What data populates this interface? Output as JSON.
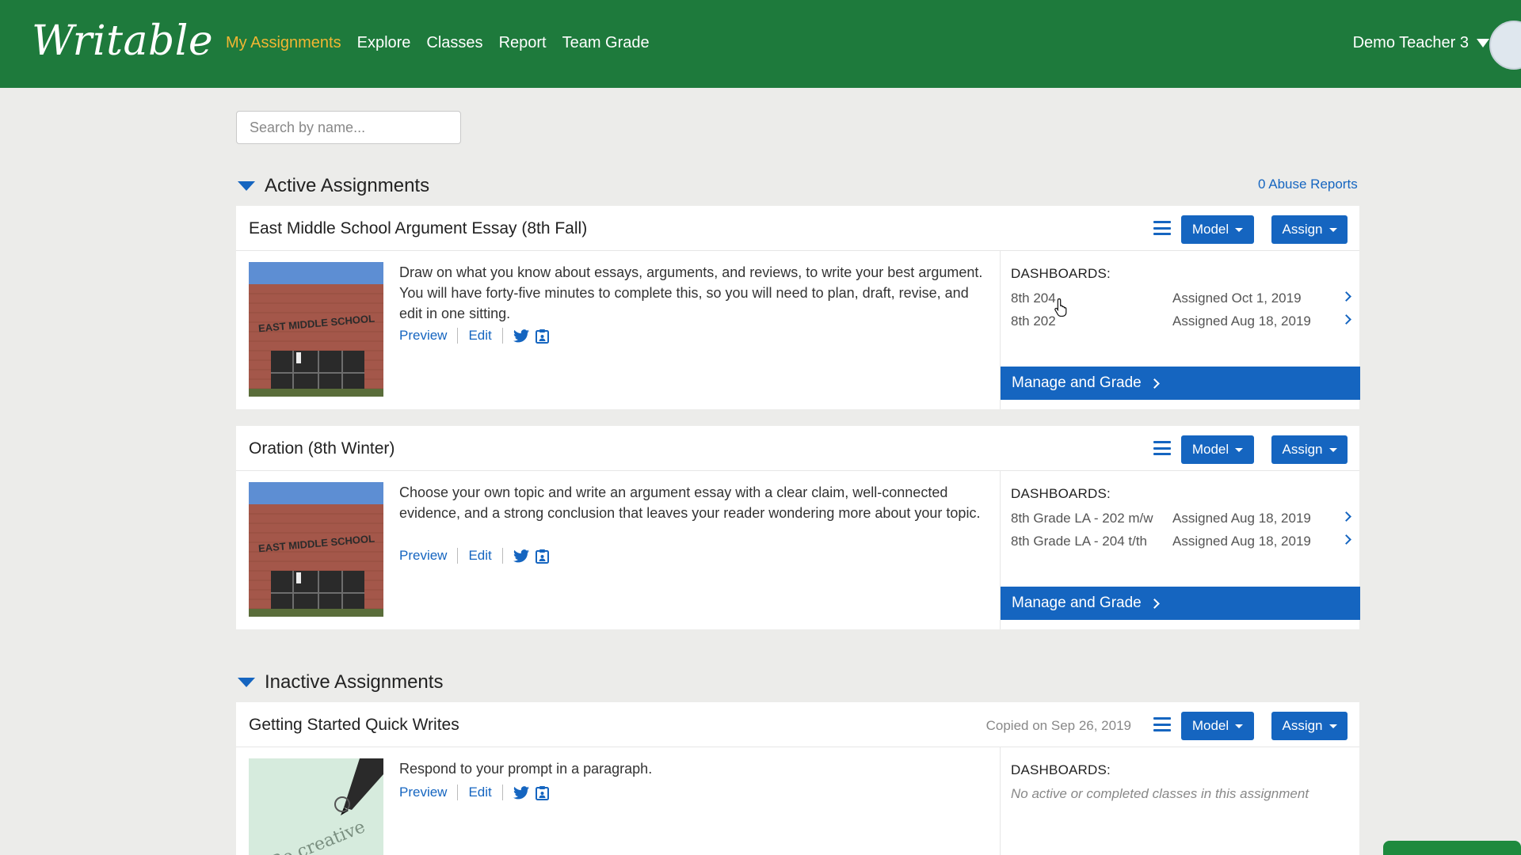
{
  "header": {
    "logo": "Writable",
    "nav": [
      "My Assignments",
      "Explore",
      "Classes",
      "Report",
      "Team Grade"
    ],
    "user": "Demo Teacher 3"
  },
  "search": {
    "placeholder": "Search by name..."
  },
  "sections": {
    "active": "Active Assignments",
    "inactive": "Inactive Assignments",
    "abuse": "0 Abuse Reports"
  },
  "labels": {
    "model": "Model",
    "assign": "Assign",
    "preview": "Preview",
    "edit": "Edit",
    "dashboards": "DASHBOARDS:",
    "manage": "Manage and Grade"
  },
  "assignments": [
    {
      "title": "East Middle School Argument Essay (8th Fall)",
      "description": "Draw on what you know about essays, arguments, and reviews, to write your best argument. You will have forty-five minutes to complete this, so you will need to plan, draft, revise, and edit in one sitting.",
      "dashboards": [
        {
          "class": "8th 204",
          "assigned": "Assigned Oct 1, 2019"
        },
        {
          "class": "8th 202",
          "assigned": "Assigned Aug 18, 2019"
        }
      ]
    },
    {
      "title": "Oration (8th Winter)",
      "description": "Choose your own topic and write an argument essay with a clear claim, well-connected evidence, and a strong conclusion that leaves your reader wondering more about your topic.",
      "dashboards": [
        {
          "class": "8th Grade LA - 202 m/w",
          "assigned": "Assigned Aug 18, 2019"
        },
        {
          "class": "8th Grade LA - 204 t/th",
          "assigned": "Assigned Aug 18, 2019"
        }
      ]
    },
    {
      "title": "Getting Started Quick Writes",
      "copied": "Copied on Sep 26, 2019",
      "description": "Respond to your prompt in a paragraph.",
      "empty": "No active or completed classes in this assignment"
    }
  ],
  "thumbnails": {
    "school_sign": "EAST MIDDLE SCHOOL",
    "creative_word": "Be creative"
  },
  "colors": {
    "header": "#1e7a3c",
    "accent": "#1565c0",
    "active_nav": "#f2b632"
  }
}
